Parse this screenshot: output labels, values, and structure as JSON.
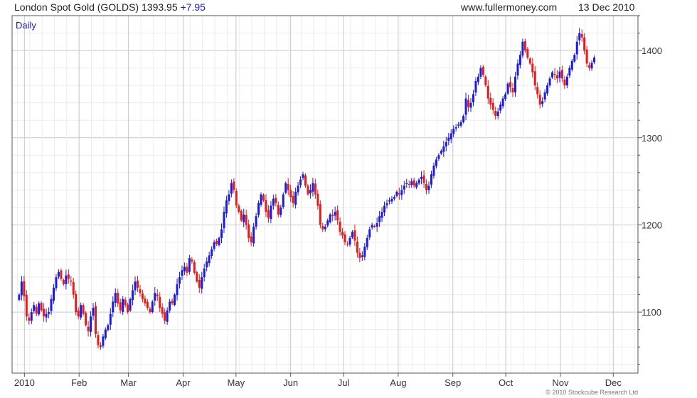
{
  "header": {
    "instrument": "London Spot Gold (GOLDS)",
    "price": "1393.95",
    "change": "+7.95",
    "site": "www.fullermoney.com",
    "date": "13 Dec 2010"
  },
  "footer": {
    "copyright": "© 2010 Stockcube Research Ltd"
  },
  "colors": {
    "up": "#1a1ae6",
    "down": "#e61a1a",
    "grid": "#c8c8c8",
    "frame": "#555555"
  },
  "chart_data": {
    "type": "candlestick",
    "period_label": "Daily",
    "y_axis_side": "right",
    "ylim": [
      1030,
      1440
    ],
    "y_ticks": [
      1100,
      1200,
      1300,
      1400
    ],
    "x_ticks": [
      {
        "label": "2010",
        "day": 4
      },
      {
        "label": "Feb",
        "day": 35
      },
      {
        "label": "Mar",
        "day": 63
      },
      {
        "label": "Apr",
        "day": 94
      },
      {
        "label": "May",
        "day": 124
      },
      {
        "label": "Jun",
        "day": 155
      },
      {
        "label": "Jul",
        "day": 185
      },
      {
        "label": "Aug",
        "day": 216
      },
      {
        "label": "Sep",
        "day": 247
      },
      {
        "label": "Oct",
        "day": 277
      },
      {
        "label": "Nov",
        "day": 308
      },
      {
        "label": "Dec",
        "day": 338
      }
    ],
    "x_range_days": [
      -3,
      352
    ],
    "close_series": {
      "start_day": 1,
      "step_days": 1.4,
      "values": [
        1120,
        1135,
        1118,
        1095,
        1090,
        1100,
        1108,
        1098,
        1110,
        1102,
        1095,
        1098,
        1100,
        1115,
        1128,
        1140,
        1146,
        1138,
        1132,
        1142,
        1138,
        1135,
        1120,
        1100,
        1095,
        1108,
        1098,
        1085,
        1078,
        1095,
        1105,
        1075,
        1062,
        1060,
        1072,
        1080,
        1085,
        1098,
        1112,
        1122,
        1110,
        1102,
        1115,
        1108,
        1100,
        1115,
        1125,
        1135,
        1128,
        1122,
        1115,
        1110,
        1105,
        1100,
        1112,
        1122,
        1118,
        1105,
        1098,
        1090,
        1102,
        1112,
        1110,
        1120,
        1132,
        1140,
        1148,
        1152,
        1145,
        1162,
        1158,
        1145,
        1135,
        1128,
        1140,
        1150,
        1158,
        1165,
        1172,
        1180,
        1178,
        1185,
        1195,
        1215,
        1228,
        1235,
        1248,
        1240,
        1222,
        1215,
        1205,
        1212,
        1200,
        1185,
        1180,
        1198,
        1210,
        1225,
        1235,
        1228,
        1215,
        1208,
        1222,
        1230,
        1225,
        1212,
        1220,
        1235,
        1248,
        1240,
        1232,
        1225,
        1238,
        1245,
        1252,
        1258,
        1245,
        1235,
        1240,
        1248,
        1235,
        1222,
        1200,
        1195,
        1198,
        1205,
        1212,
        1210,
        1215,
        1205,
        1192,
        1188,
        1180,
        1178,
        1185,
        1192,
        1182,
        1168,
        1162,
        1165,
        1175,
        1185,
        1195,
        1200,
        1198,
        1202,
        1210,
        1215,
        1222,
        1225,
        1228,
        1230,
        1232,
        1238,
        1235,
        1240,
        1245,
        1248,
        1246,
        1250,
        1245,
        1248,
        1252,
        1255,
        1248,
        1240,
        1245,
        1258,
        1268,
        1275,
        1280,
        1285,
        1290,
        1295,
        1300,
        1305,
        1310,
        1312,
        1315,
        1318,
        1325,
        1345,
        1335,
        1340,
        1350,
        1365,
        1370,
        1380,
        1372,
        1360,
        1345,
        1338,
        1332,
        1325,
        1330,
        1338,
        1345,
        1350,
        1362,
        1358,
        1352,
        1370,
        1385,
        1395,
        1410,
        1400,
        1392,
        1385,
        1375,
        1360,
        1350,
        1338,
        1342,
        1352,
        1360,
        1368,
        1375,
        1372,
        1368,
        1376,
        1368,
        1360,
        1370,
        1380,
        1388,
        1395,
        1410,
        1420,
        1415,
        1400,
        1385,
        1380,
        1386,
        1392
      ]
    }
  }
}
